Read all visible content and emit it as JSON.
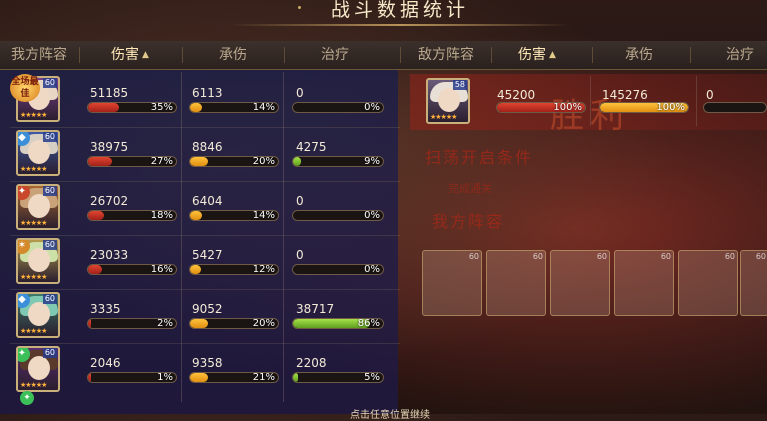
{
  "title": "战斗数据统计",
  "headers": {
    "our_team": "我方阵容",
    "damage": "伤害",
    "taken": "承伤",
    "healing": "治疗",
    "enemy_team": "敌方阵容",
    "enemy_damage": "伤害",
    "enemy_taken": "承伤",
    "enemy_healing": "治疗",
    "sort_arrow": "▲"
  },
  "mvp_badge": "全场最佳",
  "our_rows": [
    {
      "level": "60",
      "damage": "51185",
      "damage_pct": "35%",
      "damage_frac": 0.35,
      "taken": "6113",
      "taken_pct": "14%",
      "taken_frac": 0.14,
      "heal": "0",
      "heal_pct": "0%",
      "heal_frac": 0.0
    },
    {
      "level": "60",
      "damage": "38975",
      "damage_pct": "27%",
      "damage_frac": 0.27,
      "taken": "8846",
      "taken_pct": "20%",
      "taken_frac": 0.2,
      "heal": "4275",
      "heal_pct": "9%",
      "heal_frac": 0.09
    },
    {
      "level": "60",
      "damage": "26702",
      "damage_pct": "18%",
      "damage_frac": 0.18,
      "taken": "6404",
      "taken_pct": "14%",
      "taken_frac": 0.14,
      "heal": "0",
      "heal_pct": "0%",
      "heal_frac": 0.0
    },
    {
      "level": "60",
      "damage": "23033",
      "damage_pct": "16%",
      "damage_frac": 0.16,
      "taken": "5427",
      "taken_pct": "12%",
      "taken_frac": 0.12,
      "heal": "0",
      "heal_pct": "0%",
      "heal_frac": 0.0
    },
    {
      "level": "60",
      "damage": "3335",
      "damage_pct": "2%",
      "damage_frac": 0.02,
      "taken": "9052",
      "taken_pct": "20%",
      "taken_frac": 0.2,
      "heal": "38717",
      "heal_pct": "86%",
      "heal_frac": 0.86
    },
    {
      "level": "60",
      "damage": "2046",
      "damage_pct": "1%",
      "damage_frac": 0.01,
      "taken": "9358",
      "taken_pct": "21%",
      "taken_frac": 0.21,
      "heal": "2208",
      "heal_pct": "5%",
      "heal_frac": 0.05
    }
  ],
  "enemy_rows": [
    {
      "level": "58",
      "damage": "45200",
      "damage_pct": "100%",
      "damage_frac": 1.0,
      "taken": "145276",
      "taken_pct": "100%",
      "taken_frac": 1.0,
      "heal": "0"
    }
  ],
  "background": {
    "win_text": "胜利",
    "sweep_title": "扫荡开启条件",
    "sweep_sub": "完成通关",
    "our_team_label": "我方阵容",
    "ghost_levels": [
      "60",
      "60",
      "60",
      "60",
      "60",
      "60"
    ]
  },
  "footer_text": "点击任意位置继续",
  "colors": {
    "damage": "#c8321f",
    "taken": "#f0a21e",
    "healing": "#7cc232"
  }
}
